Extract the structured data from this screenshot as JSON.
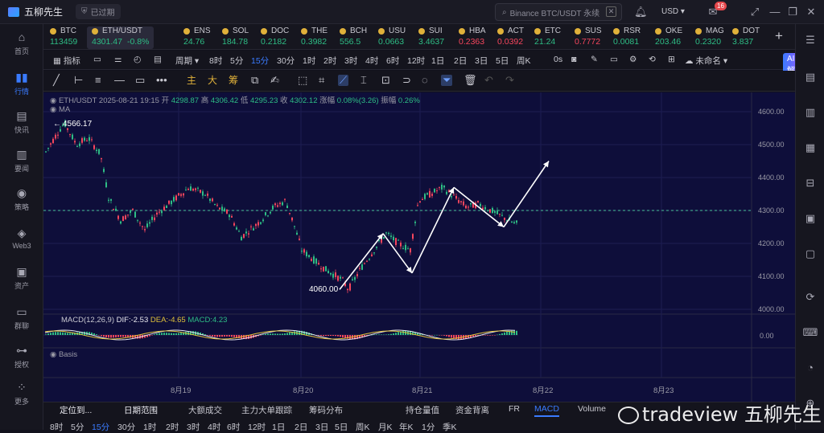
{
  "app": {
    "name": "五柳先生",
    "status": "已过期"
  },
  "search": {
    "placeholder": "Binance BTC/USDT 永续"
  },
  "topbar": {
    "currency": "USD",
    "notifications": "16"
  },
  "leftnav": [
    {
      "label": "首页",
      "icon": "home-icon",
      "glyph": "⌂"
    },
    {
      "label": "行情",
      "icon": "market-icon",
      "glyph": "▮▮",
      "active": true
    },
    {
      "label": "快讯",
      "icon": "flash-icon",
      "glyph": "▤"
    },
    {
      "label": "要闻",
      "icon": "news-icon",
      "glyph": "▥"
    },
    {
      "label": "策略",
      "icon": "strategy-icon",
      "glyph": "◉"
    },
    {
      "label": "Web3",
      "icon": "web3-icon",
      "glyph": "◈"
    },
    {
      "label": "资产",
      "icon": "wallet-icon",
      "glyph": "▣"
    },
    {
      "label": "群聊",
      "icon": "chat-icon",
      "glyph": "▭"
    },
    {
      "label": "授权",
      "icon": "key-icon",
      "glyph": "⊶"
    },
    {
      "label": "更多",
      "icon": "more-icon",
      "glyph": "⁘"
    }
  ],
  "tickers": [
    {
      "sym": "BTC",
      "price": "113459",
      "dir": "up"
    },
    {
      "sym": "ETH/USDT",
      "price": "4301.47",
      "change": "-0.8%",
      "dir": "up",
      "active": true
    },
    {
      "sym": "ENS",
      "price": "24.76",
      "dir": "up"
    },
    {
      "sym": "SOL",
      "price": "184.78",
      "dir": "up"
    },
    {
      "sym": "DOC",
      "price": "0.2182",
      "dir": "up"
    },
    {
      "sym": "THE",
      "price": "0.3982",
      "dir": "up"
    },
    {
      "sym": "BCH",
      "price": "556.5",
      "dir": "up"
    },
    {
      "sym": "USU",
      "price": "0.0663",
      "dir": "up"
    },
    {
      "sym": "SUI",
      "price": "3.4637",
      "dir": "up"
    },
    {
      "sym": "HBA",
      "price": "0.2363",
      "dir": "dn"
    },
    {
      "sym": "ACT",
      "price": "0.0392",
      "dir": "dn"
    },
    {
      "sym": "ETC",
      "price": "21.24",
      "dir": "up"
    },
    {
      "sym": "SUS",
      "price": "0.7772",
      "dir": "dn"
    },
    {
      "sym": "RSR",
      "price": "0.0081",
      "dir": "up"
    },
    {
      "sym": "OKE",
      "price": "203.46",
      "dir": "up"
    },
    {
      "sym": "MAG",
      "price": "0.2320",
      "dir": "up"
    },
    {
      "sym": "DOT",
      "price": "3.837",
      "dir": "up"
    }
  ],
  "intervalbar": {
    "indicators": "指标",
    "period": "周期",
    "intervals": [
      "8时",
      "5分",
      "15分",
      "30分",
      "1时",
      "2时",
      "3时",
      "4时",
      "6时",
      "12时",
      "1日",
      "2日",
      "3日",
      "5日",
      "周K"
    ],
    "active_interval": "15分",
    "os": "0s",
    "unnamed": "未命名",
    "ai": "AI解读"
  },
  "drawbar": {
    "labels": [
      "主",
      "大",
      "筹"
    ]
  },
  "chart_header": {
    "symbol": "ETH/USDT",
    "datetime": "2025-08-21 19:15",
    "open_label": "开",
    "open": "4298.87",
    "high_label": "高",
    "high": "4306.42",
    "low_label": "低",
    "low": "4295.23",
    "close_label": "收",
    "close": "4302.12",
    "chg_label": "涨幅",
    "chg": "0.08%(3.26)",
    "amp_label": "振幅",
    "amp": "0.26%",
    "ma": "MA"
  },
  "macd": {
    "label": "MACD(12,26,9)",
    "dif": "DIF:-2.53",
    "dea": "DEA:-4.65",
    "macd": "MACD:4.23",
    "zero": "0.00"
  },
  "basis": {
    "label": "Basis"
  },
  "chart_data": {
    "type": "candlestick",
    "symbol": "ETH/USDT",
    "interval": "15分",
    "ylim": [
      4000,
      4600
    ],
    "yticks": [
      "4600.00",
      "4500.00",
      "4400.00",
      "4300.00",
      "4200.00",
      "4100.00",
      "4000.00"
    ],
    "xticks": [
      "8月19",
      "8月20",
      "8月21",
      "8月22",
      "8月23"
    ],
    "high_annotation": "4566.17",
    "low_annotation": "4060.00",
    "current_price_line": 4300,
    "path_points": [
      {
        "t": 0.0,
        "v": 4060
      },
      {
        "t": 0.14,
        "v": 4230
      },
      {
        "t": 0.25,
        "v": 4110
      },
      {
        "t": 0.3,
        "v": 4240
      },
      {
        "t": 0.36,
        "v": 4370
      },
      {
        "t": 0.42,
        "v": 4330
      },
      {
        "t": 0.5,
        "v": 4280
      },
      {
        "t": 0.56,
        "v": 4250
      },
      {
        "t": 0.63,
        "v": 4300
      },
      {
        "t": 0.72,
        "v": 4320
      },
      {
        "t": 0.8,
        "v": 4450
      }
    ]
  },
  "bottombar": {
    "tabs": [
      "定位到...",
      "日期范围",
      "大额成交",
      "主力大单跟踪",
      "筹码分布",
      "持仓量值",
      "资金背离",
      "FR",
      "MACD",
      "Volume"
    ],
    "active_tab": "MACD",
    "intervals": [
      "8时",
      "5分",
      "15分",
      "30分",
      "1时",
      "2时",
      "3时",
      "4时",
      "6时",
      "12时",
      "1日",
      "2日",
      "3日",
      "5日",
      "周K",
      "月K",
      "年K",
      "1分",
      "季K"
    ],
    "active_interval": "15分"
  },
  "watermark": "tradeview 五柳先生"
}
